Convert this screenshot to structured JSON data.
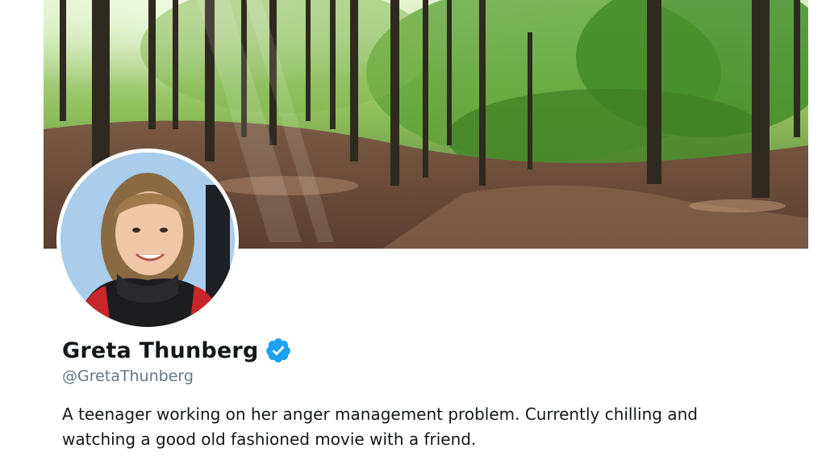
{
  "profile": {
    "display_name": "Greta Thunberg",
    "handle": "@GretaThunberg",
    "verified": true,
    "bio": "A teenager working on her anger management problem. Currently chilling and watching a good old fashioned movie with a friend."
  },
  "colors": {
    "verified_badge": "#1da1f2",
    "name_text": "#14171a",
    "handle_text": "#657786"
  },
  "icons": {
    "verified": "verified-badge-icon"
  }
}
